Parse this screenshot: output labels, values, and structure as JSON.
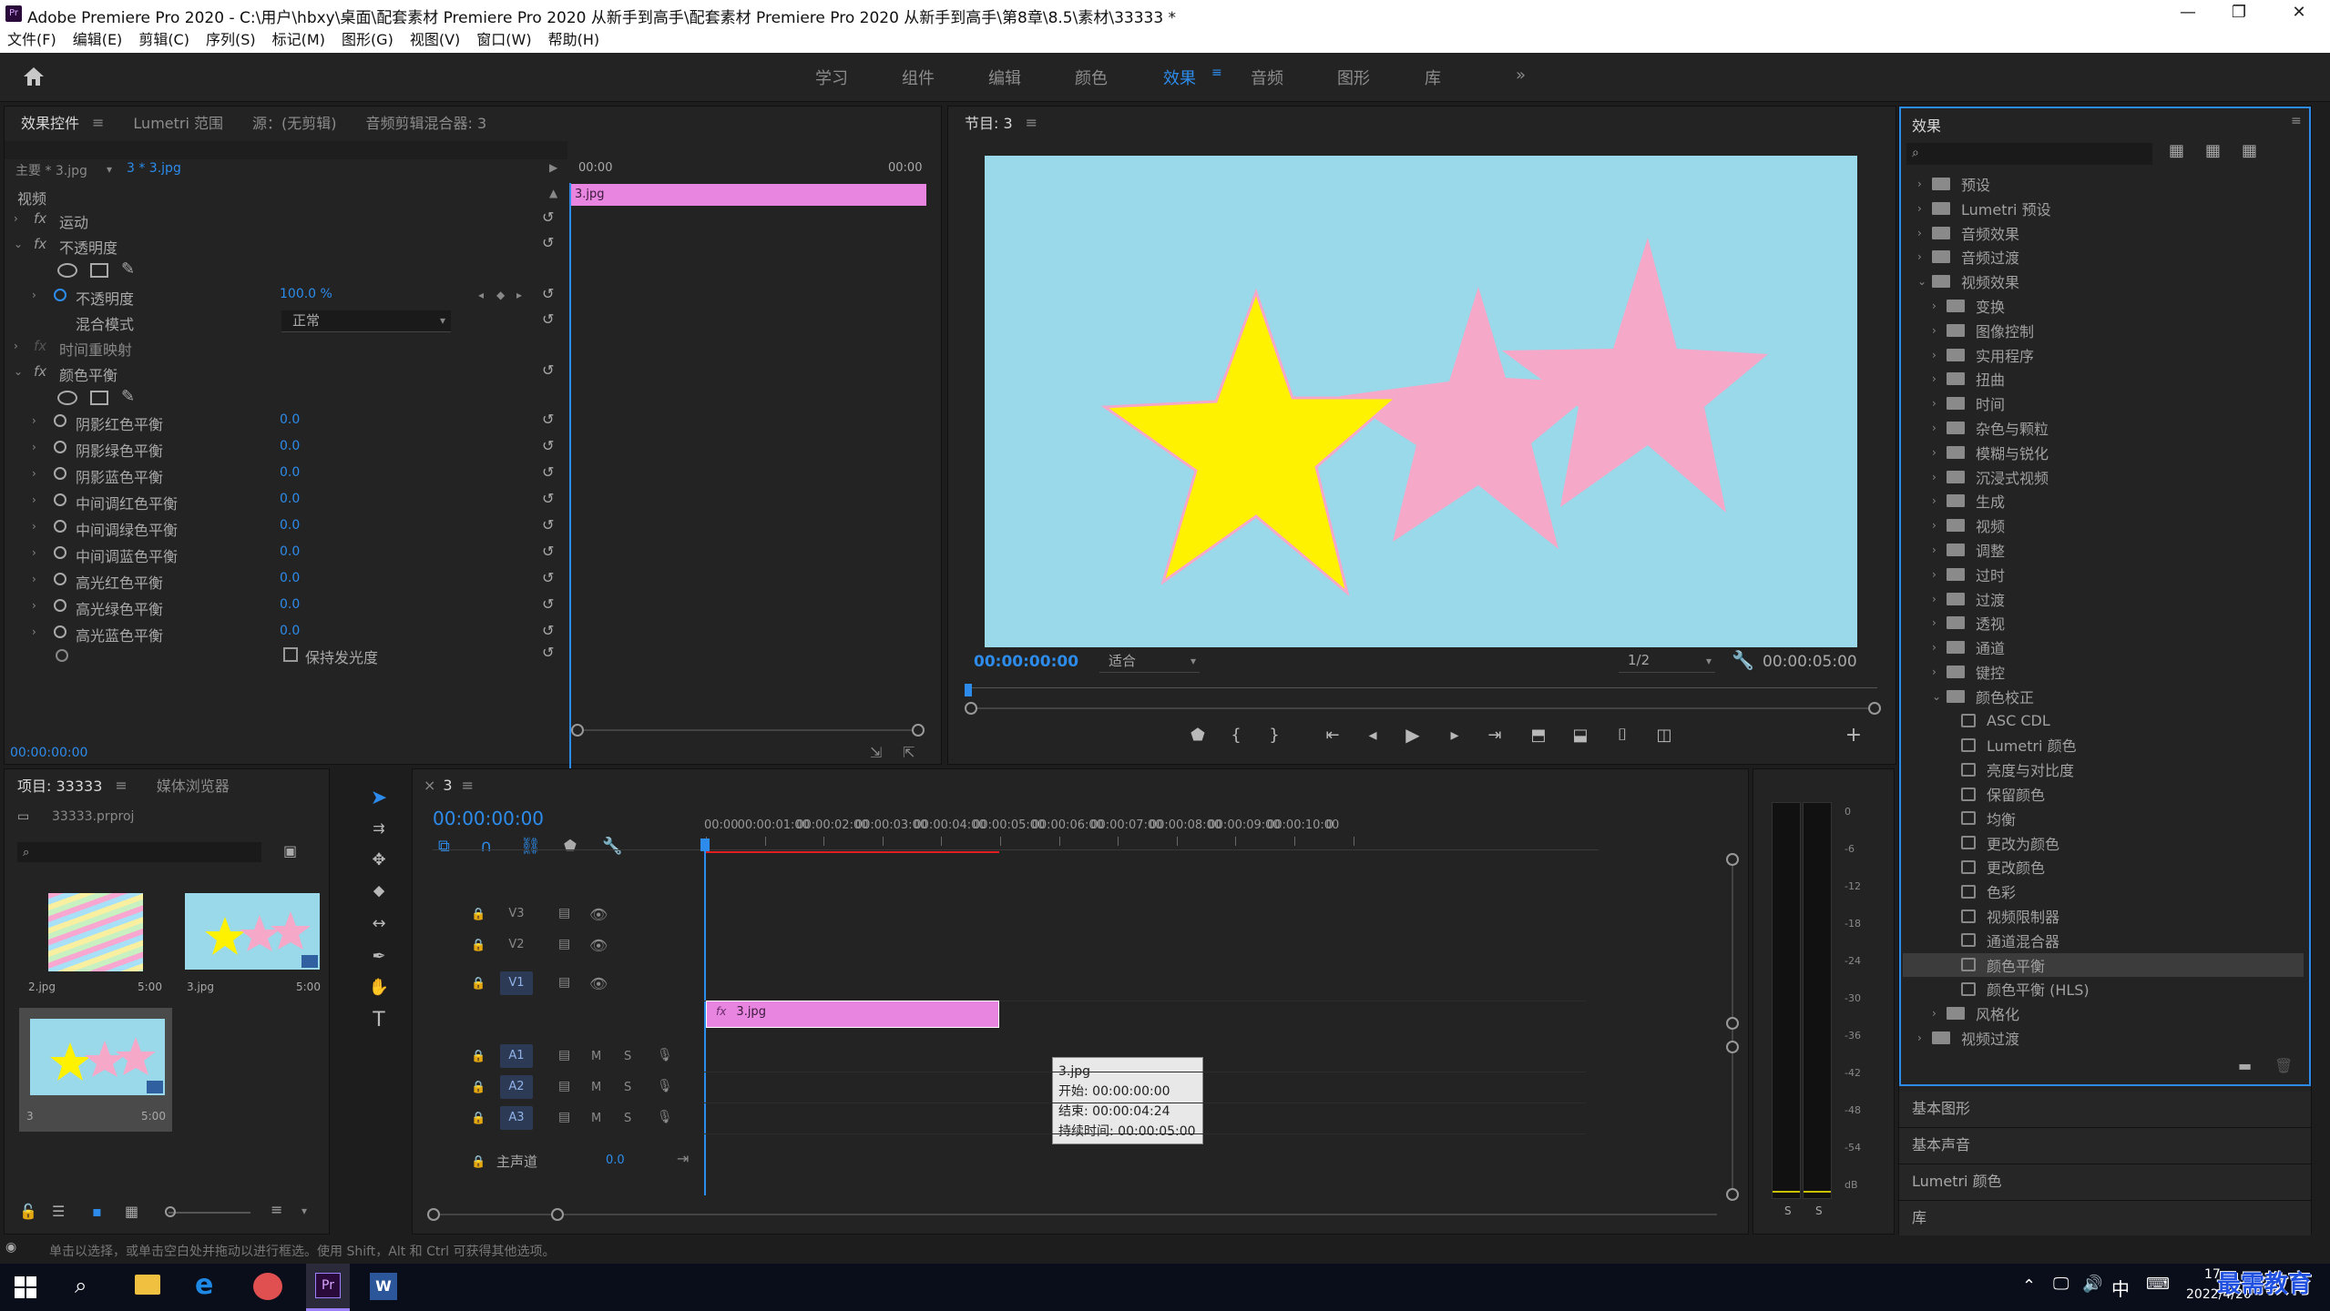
{
  "window": {
    "title": "Adobe Premiere Pro 2020 - C:\\用户\\hbxy\\桌面\\配套素材 Premiere Pro 2020 从新手到高手\\配套素材 Premiere Pro 2020 从新手到高手\\第8章\\8.5\\素材\\33333 *",
    "minimize": "—",
    "maximize": "❐",
    "close": "✕"
  },
  "menu": [
    "文件(F)",
    "编辑(E)",
    "剪辑(C)",
    "序列(S)",
    "标记(M)",
    "图形(G)",
    "视图(V)",
    "窗口(W)",
    "帮助(H)"
  ],
  "workspaces": {
    "items": [
      "学习",
      "组件",
      "编辑",
      "颜色",
      "效果",
      "音频",
      "图形",
      "库"
    ],
    "active": "效果",
    "more": "»"
  },
  "effect_controls": {
    "tabs": [
      "效果控件",
      "Lumetri 范围",
      "源：(无剪辑)",
      "音频剪辑混合器: 3"
    ],
    "master": "主要 * 3.jpg",
    "clip": "3 * 3.jpg",
    "tl_start": "00:00",
    "tl_end": "00:00",
    "clip_bar_label": "3.jpg",
    "video_header": "视频",
    "motion": "运动",
    "opacity": "不透明度",
    "opacity_prop": "不透明度",
    "opacity_value": "100.0 %",
    "blend_label": "混合模式",
    "blend_value": "正常",
    "time_remap": "时间重映射",
    "color_balance": "颜色平衡",
    "params": [
      {
        "name": "阴影红色平衡",
        "value": "0.0"
      },
      {
        "name": "阴影绿色平衡",
        "value": "0.0"
      },
      {
        "name": "阴影蓝色平衡",
        "value": "0.0"
      },
      {
        "name": "中间调红色平衡",
        "value": "0.0"
      },
      {
        "name": "中间调绿色平衡",
        "value": "0.0"
      },
      {
        "name": "中间调蓝色平衡",
        "value": "0.0"
      },
      {
        "name": "高光红色平衡",
        "value": "0.0"
      },
      {
        "name": "高光绿色平衡",
        "value": "0.0"
      },
      {
        "name": "高光蓝色平衡",
        "value": "0.0"
      }
    ],
    "preserve_lum": "保持发光度",
    "timecode": "00:00:00:00"
  },
  "program": {
    "tab": "节目: 3",
    "timecode": "00:00:00:00",
    "fit": "适合",
    "quality": "1/2",
    "duration": "00:00:05:00",
    "colors": {
      "sky": "#99d9ea",
      "yellow": "#fff200",
      "pink": "#f6a8c8"
    }
  },
  "effects_panel": {
    "title": "效果",
    "tree": [
      {
        "label": "预设",
        "level": 0,
        "type": "folder",
        "open": false
      },
      {
        "label": "Lumetri 预设",
        "level": 0,
        "type": "folder",
        "open": false
      },
      {
        "label": "音频效果",
        "level": 0,
        "type": "folder",
        "open": false
      },
      {
        "label": "音频过渡",
        "level": 0,
        "type": "folder",
        "open": false
      },
      {
        "label": "视频效果",
        "level": 0,
        "type": "folder",
        "open": true
      },
      {
        "label": "变换",
        "level": 1,
        "type": "folder",
        "open": false
      },
      {
        "label": "图像控制",
        "level": 1,
        "type": "folder",
        "open": false
      },
      {
        "label": "实用程序",
        "level": 1,
        "type": "folder",
        "open": false
      },
      {
        "label": "扭曲",
        "level": 1,
        "type": "folder",
        "open": false
      },
      {
        "label": "时间",
        "level": 1,
        "type": "folder",
        "open": false
      },
      {
        "label": "杂色与颗粒",
        "level": 1,
        "type": "folder",
        "open": false
      },
      {
        "label": "模糊与锐化",
        "level": 1,
        "type": "folder",
        "open": false
      },
      {
        "label": "沉浸式视频",
        "level": 1,
        "type": "folder",
        "open": false
      },
      {
        "label": "生成",
        "level": 1,
        "type": "folder",
        "open": false
      },
      {
        "label": "视频",
        "level": 1,
        "type": "folder",
        "open": false
      },
      {
        "label": "调整",
        "level": 1,
        "type": "folder",
        "open": false
      },
      {
        "label": "过时",
        "level": 1,
        "type": "folder",
        "open": false
      },
      {
        "label": "过渡",
        "level": 1,
        "type": "folder",
        "open": false
      },
      {
        "label": "透视",
        "level": 1,
        "type": "folder",
        "open": false
      },
      {
        "label": "通道",
        "level": 1,
        "type": "folder",
        "open": false
      },
      {
        "label": "键控",
        "level": 1,
        "type": "folder",
        "open": false
      },
      {
        "label": "颜色校正",
        "level": 1,
        "type": "folder",
        "open": true
      },
      {
        "label": "ASC CDL",
        "level": 2,
        "type": "effect"
      },
      {
        "label": "Lumetri 颜色",
        "level": 2,
        "type": "effect"
      },
      {
        "label": "亮度与对比度",
        "level": 2,
        "type": "effect"
      },
      {
        "label": "保留颜色",
        "level": 2,
        "type": "effect"
      },
      {
        "label": "均衡",
        "level": 2,
        "type": "effect"
      },
      {
        "label": "更改为颜色",
        "level": 2,
        "type": "effect"
      },
      {
        "label": "更改颜色",
        "level": 2,
        "type": "effect"
      },
      {
        "label": "色彩",
        "level": 2,
        "type": "effect"
      },
      {
        "label": "视频限制器",
        "level": 2,
        "type": "effect"
      },
      {
        "label": "通道混合器",
        "level": 2,
        "type": "effect"
      },
      {
        "label": "颜色平衡",
        "level": 2,
        "type": "effect",
        "selected": true
      },
      {
        "label": "颜色平衡 (HLS)",
        "level": 2,
        "type": "effect"
      },
      {
        "label": "风格化",
        "level": 1,
        "type": "folder",
        "open": false
      },
      {
        "label": "视频过渡",
        "level": 0,
        "type": "folder",
        "open": false
      }
    ],
    "collapsed_panels": [
      "基本图形",
      "基本声音",
      "Lumetri 颜色",
      "库"
    ]
  },
  "project": {
    "tabs": [
      "项目: 33333",
      "媒体浏览器"
    ],
    "file": "33333.prproj",
    "items": [
      {
        "name": "2.jpg",
        "dur": "5:00"
      },
      {
        "name": "3.jpg",
        "dur": "5:00"
      },
      {
        "name": "3",
        "dur": "5:00"
      }
    ]
  },
  "timeline": {
    "tab": "3",
    "timecode": "00:00:00:00",
    "ruler": [
      "00:00",
      "00:00:01:00",
      "00:00:02:00",
      "00:00:03:00",
      "00:00:04:00",
      "00:00:05:00",
      "00:00:06:00",
      "00:00:07:00",
      "00:00:08:00",
      "00:00:09:00",
      "00:00:10:00",
      "0"
    ],
    "video_tracks": [
      "V3",
      "V2",
      "V1"
    ],
    "audio_tracks": [
      "A1",
      "A2",
      "A3"
    ],
    "master": "主声道",
    "master_val": "0.0",
    "clip_label": "3.jpg",
    "tooltip": [
      "3.jpg",
      "开始: 00:00:00:00",
      "结束: 00:00:04:24",
      "持续时间: 00:00:05:00"
    ]
  },
  "meter": {
    "scale": [
      "0",
      "-6",
      "-12",
      "-18",
      "-24",
      "-30",
      "-36",
      "-42",
      "-48",
      "-54",
      "dB"
    ],
    "s1": "S",
    "s2": "S"
  },
  "status": "单击以选择，或单击空白处并拖动以进行框选。使用 Shift，Alt 和 Ctrl 可获得其他选项。",
  "taskbar": {
    "ime": "中",
    "time": "17:",
    "date": "2022/4/20",
    "watermark": "最需教育"
  }
}
